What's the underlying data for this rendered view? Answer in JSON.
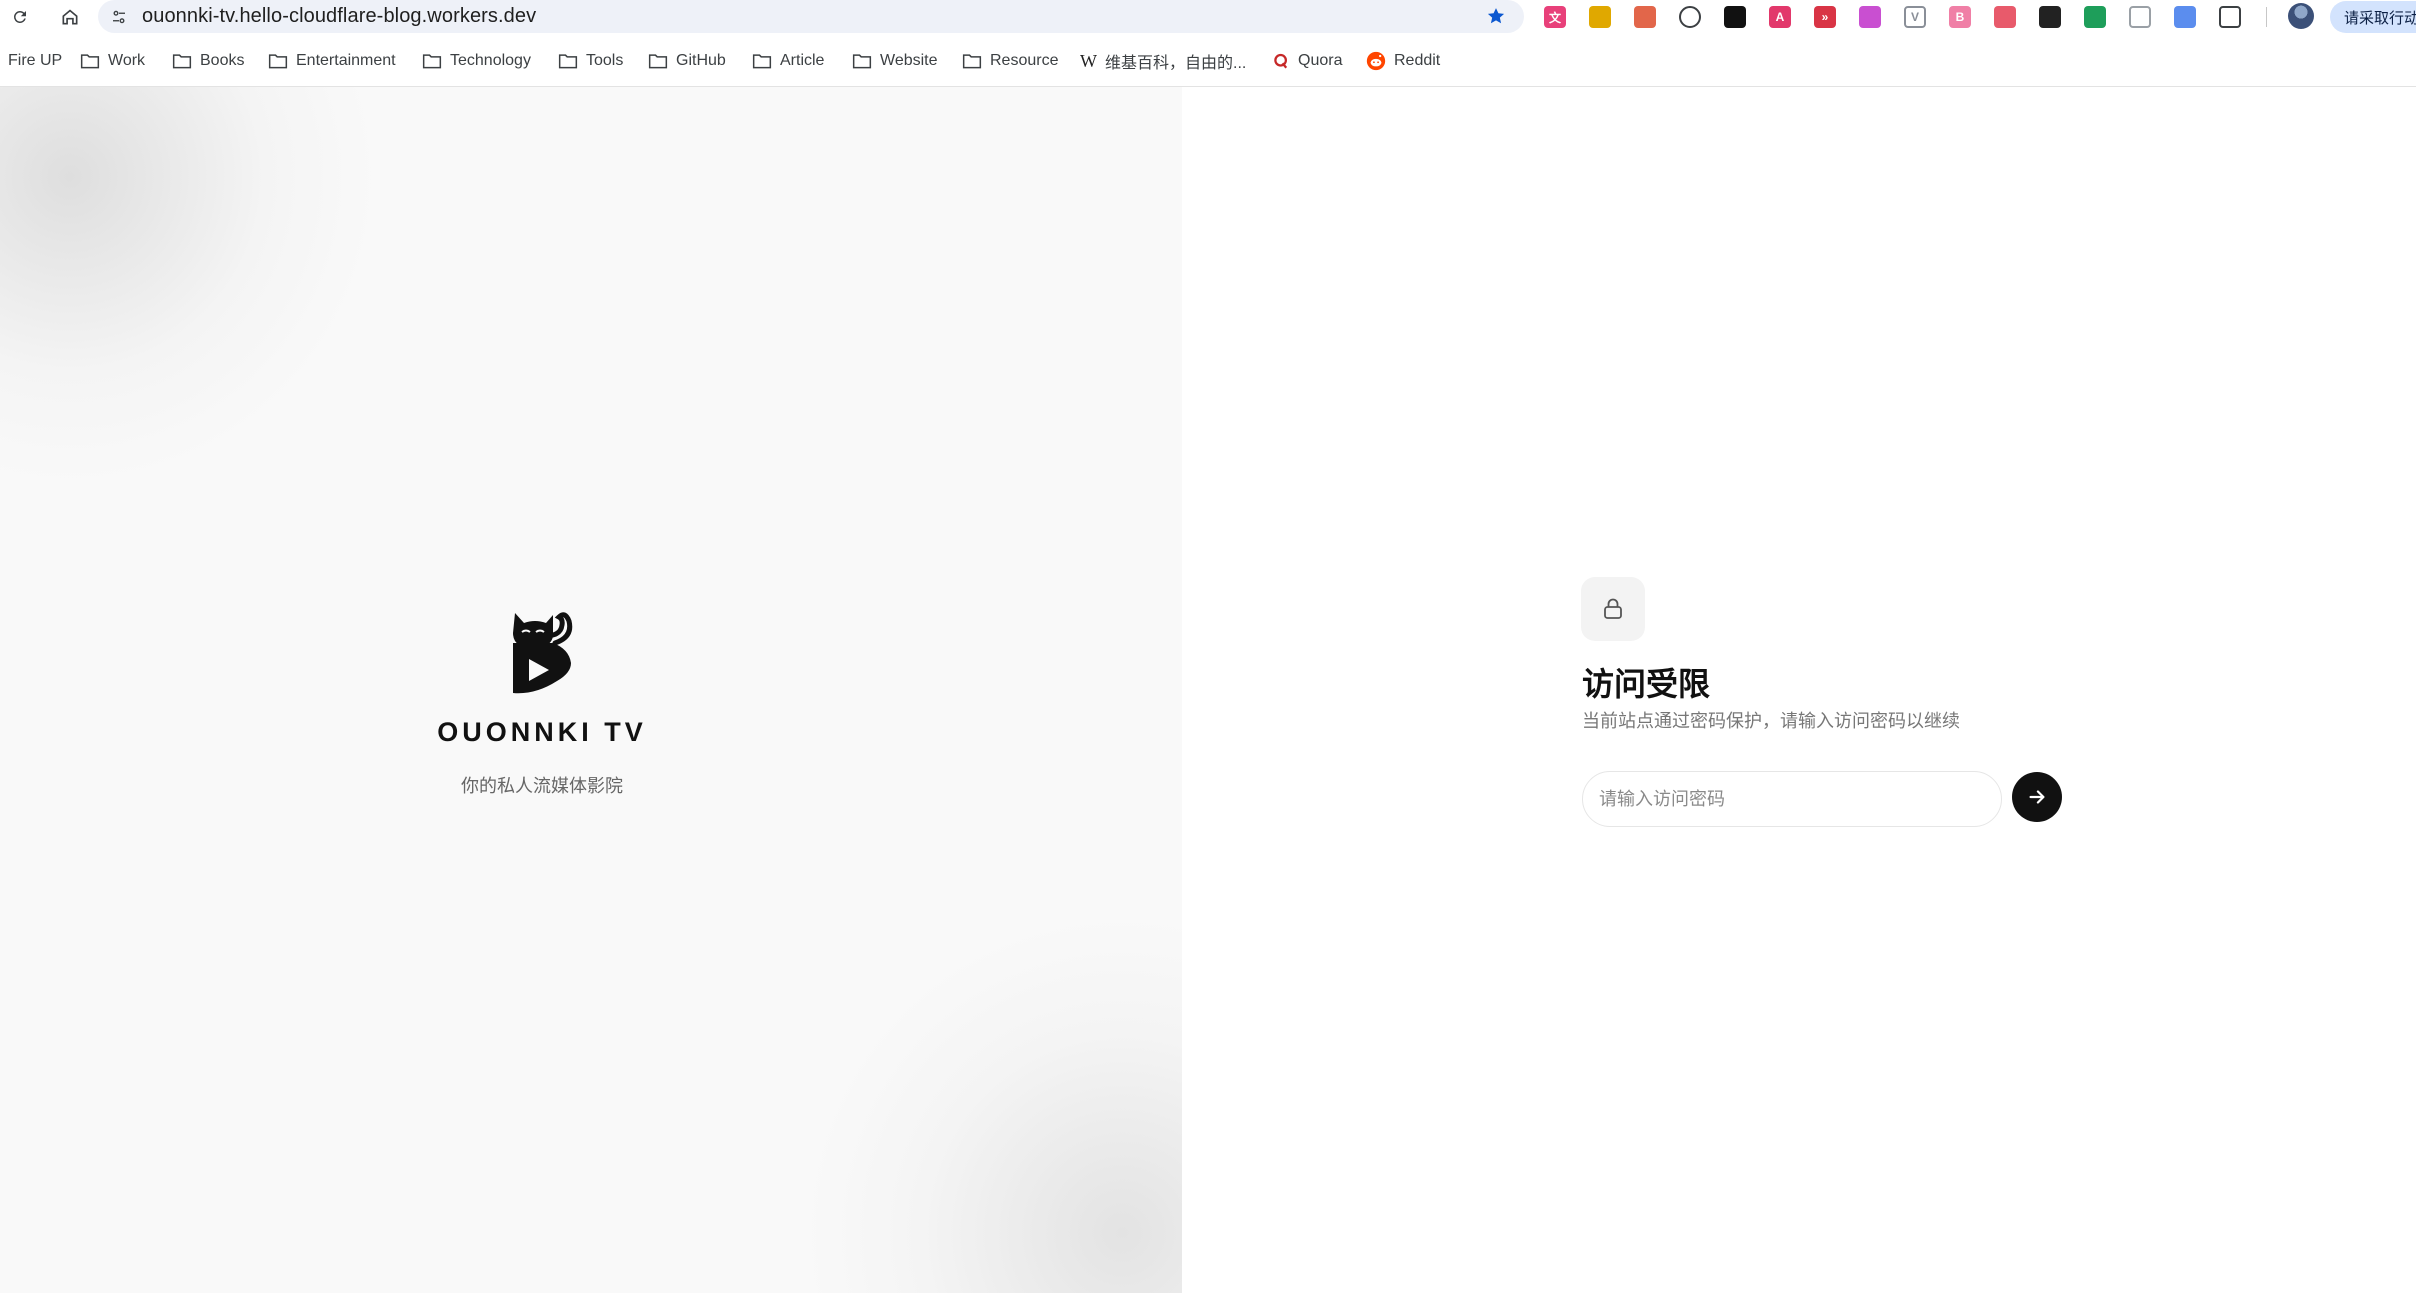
{
  "browser": {
    "url": "ouonnki-tv.hello-cloudflare-blog.workers.dev",
    "reload_icon": "reload-icon",
    "home_icon": "home-icon",
    "site_info_icon": "tune-icon",
    "bookmark_star_icon": "star-filled-icon",
    "profile_action_label": "请采取行动",
    "extensions": [
      {
        "icon": "translate-extension-icon",
        "color": "#e8407a",
        "glyph": "文"
      },
      {
        "icon": "broom-extension-icon",
        "color": "#e0a800",
        "glyph": ""
      },
      {
        "icon": "pyramid-extension-icon",
        "color": "#e2664a",
        "glyph": ""
      },
      {
        "icon": "circle-code-extension-icon",
        "color": "#3c4043",
        "glyph": ""
      },
      {
        "icon": "mask-extension-icon",
        "color": "#111111",
        "glyph": ""
      },
      {
        "icon": "text-ai-extension-icon",
        "color": "#e2386b",
        "glyph": "A"
      },
      {
        "icon": "fast-forward-extension-icon",
        "color": "#d93445",
        "glyph": "»"
      },
      {
        "icon": "gradient-share-extension-icon",
        "color": "#c94fd1",
        "glyph": ""
      },
      {
        "icon": "v-extension-icon",
        "color": "#8a8f98",
        "glyph": "V"
      },
      {
        "icon": "b-extension-icon",
        "color": "#f07fa6",
        "glyph": "B"
      },
      {
        "icon": "line-extension-icon",
        "color": "#e85a6b",
        "glyph": ""
      },
      {
        "icon": "dark-app-extension-icon",
        "color": "#222222",
        "glyph": ""
      },
      {
        "icon": "globe-extension-icon",
        "color": "#1e9e5a",
        "glyph": ""
      },
      {
        "icon": "dots-extension-icon",
        "color": "#9aa0a6",
        "glyph": ""
      },
      {
        "icon": "screen-extension-icon",
        "color": "#5b8dee",
        "glyph": ""
      },
      {
        "icon": "puzzle-extensions-icon",
        "color": "#3c4043",
        "glyph": ""
      }
    ]
  },
  "bookmarks": [
    {
      "label": "Fire UP",
      "icon": ""
    },
    {
      "label": "Work",
      "icon": "folder-icon"
    },
    {
      "label": "Books",
      "icon": "folder-icon"
    },
    {
      "label": "Entertainment",
      "icon": "folder-icon"
    },
    {
      "label": "Technology",
      "icon": "folder-icon"
    },
    {
      "label": "Tools",
      "icon": "folder-icon"
    },
    {
      "label": "GitHub",
      "icon": "folder-icon"
    },
    {
      "label": "Article",
      "icon": "folder-icon"
    },
    {
      "label": "Website",
      "icon": "folder-icon"
    },
    {
      "label": "Resource",
      "icon": "folder-icon"
    },
    {
      "label": "维基百科，自由的...",
      "icon": "wikipedia-icon"
    },
    {
      "label": "Quora",
      "icon": "quora-icon"
    },
    {
      "label": "Reddit",
      "icon": "reddit-icon"
    }
  ],
  "hero": {
    "logo_icon": "cat-play-logo-icon",
    "brand_name": "OUONNKI TV",
    "tagline": "你的私人流媒体影院"
  },
  "login": {
    "lock_icon": "lock-icon",
    "title": "访问受限",
    "subtitle": "当前站点通过密码保护，请输入访问密码以继续",
    "password_placeholder": "请输入访问密码",
    "submit_icon": "arrow-right-icon"
  },
  "colors": {
    "accent_star": "#0b57d0",
    "left_panel_bg": "#f9f9f9",
    "submit_bg": "#111111"
  }
}
